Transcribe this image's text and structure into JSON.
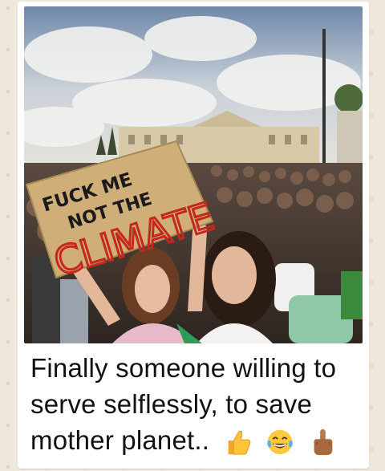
{
  "photo": {
    "sign_line1": "FUCK ME",
    "sign_line2": "NOT THE",
    "sign_line3": "CLIMATE"
  },
  "caption": {
    "text": "Finally someone willing to serve selflessly, to save mother planet..",
    "emojis": [
      "thumbs-up-icon",
      "tears-of-joy-icon",
      "middle-finger-icon"
    ]
  },
  "colors": {
    "sign_board": "#cfae78",
    "sign_ink_black": "#1a1a1a",
    "sign_ink_red": "#c4281c",
    "sky": "#aab7c6",
    "building": "#d8c9a8"
  }
}
